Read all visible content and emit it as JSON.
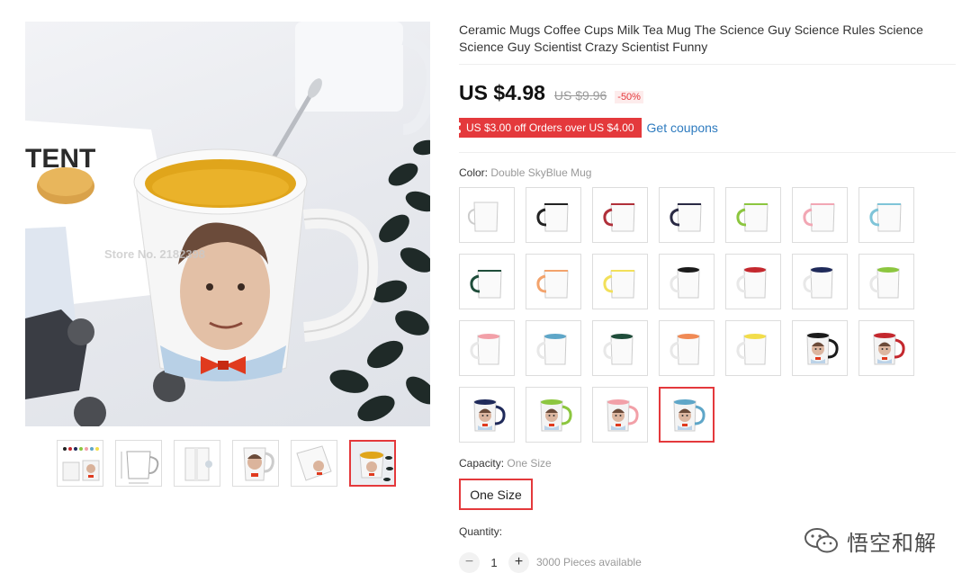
{
  "product": {
    "title": "Ceramic Mugs Coffee Cups Milk Tea Mug The Science Guy Science Rules Science Science Guy Scientist Crazy Scientist Funny"
  },
  "price": {
    "current": "US $4.98",
    "original": "US $9.96",
    "discount": "-50%"
  },
  "coupon": {
    "tag": "US $3.00 off Orders over US $4.00",
    "link": "Get coupons"
  },
  "color": {
    "label": "Color:",
    "selected": "Double SkyBlue Mug",
    "swatches": [
      {
        "type": "plain",
        "accent": "#ffffff"
      },
      {
        "type": "handle",
        "accent": "#222222"
      },
      {
        "type": "handle",
        "accent": "#b0303a"
      },
      {
        "type": "handle",
        "accent": "#2a2a44"
      },
      {
        "type": "handle",
        "accent": "#8cc63f"
      },
      {
        "type": "handle",
        "accent": "#f2a7b4"
      },
      {
        "type": "handle",
        "accent": "#7fc4d8"
      },
      {
        "type": "handle",
        "accent": "#1f4d3a"
      },
      {
        "type": "handle",
        "accent": "#f3a36c"
      },
      {
        "type": "handle",
        "accent": "#f2e05a"
      },
      {
        "type": "inner",
        "accent": "#1b1b1b"
      },
      {
        "type": "inner",
        "accent": "#c4282e"
      },
      {
        "type": "inner",
        "accent": "#1f2a5a"
      },
      {
        "type": "inner",
        "accent": "#8cc63f"
      },
      {
        "type": "inner",
        "accent": "#f2a0a8"
      },
      {
        "type": "inner",
        "accent": "#5ea6c8"
      },
      {
        "type": "inner",
        "accent": "#1f4d3a"
      },
      {
        "type": "inner",
        "accent": "#f08a55"
      },
      {
        "type": "inner",
        "accent": "#f2dd4a"
      },
      {
        "type": "print",
        "accent": "#1b1b1b"
      },
      {
        "type": "print",
        "accent": "#c4282e"
      },
      {
        "type": "print",
        "accent": "#1f2a5a"
      },
      {
        "type": "print",
        "accent": "#8cc63f"
      },
      {
        "type": "print",
        "accent": "#f2a0a8"
      },
      {
        "type": "print",
        "accent": "#5ea6c8"
      }
    ],
    "selected_index": 24
  },
  "capacity": {
    "label": "Capacity:",
    "selected": "One Size",
    "option": "One Size"
  },
  "quantity": {
    "label": "Quantity:",
    "value": "1",
    "minus": "−",
    "plus": "+",
    "available": "3000 Pieces available"
  },
  "gallery": {
    "main_caption_text": "TENT",
    "store_watermark": "Store No. 2182398",
    "thumb_count": 6,
    "selected_thumb": 5
  },
  "watermark": {
    "text": "悟空和解",
    "icon": "wechat-icon"
  },
  "colors": {
    "accent": "#e4393c",
    "link": "#2e7bbf"
  }
}
